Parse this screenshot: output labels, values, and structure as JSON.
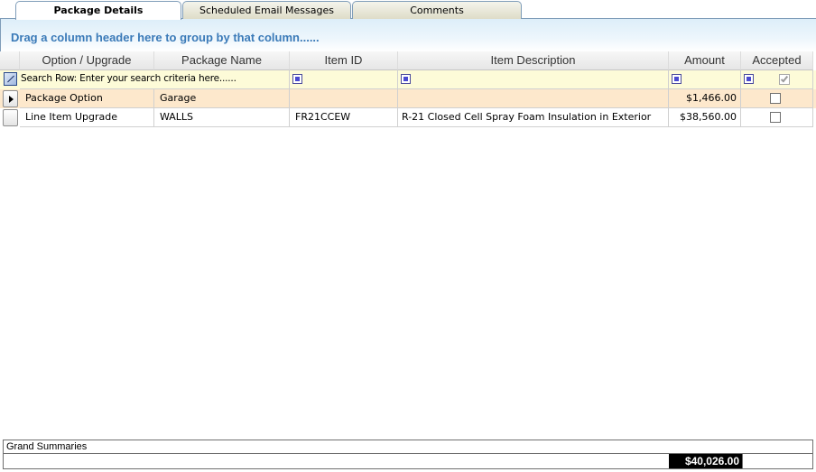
{
  "tabs": [
    {
      "label": "Package Details",
      "active": true
    },
    {
      "label": "Scheduled Email Messages",
      "active": false
    },
    {
      "label": "Comments",
      "active": false
    }
  ],
  "groupby": {
    "prompt": "Drag a column header here to group by that column......"
  },
  "columns": {
    "option": "Option / Upgrade",
    "package": "Package Name",
    "item_id": "Item ID",
    "description": "Item Description",
    "amount": "Amount",
    "accepted": "Accepted"
  },
  "search_row": {
    "prompt": "Search Row: Enter your search criteria here......",
    "accepted_checked": true
  },
  "rows": [
    {
      "option": "Package Option",
      "package": "Garage",
      "item_id": "",
      "description": "",
      "amount": "$1,466.00",
      "accepted": false
    },
    {
      "option": "Line Item Upgrade",
      "package": "WALLS",
      "item_id": "FR21CCEW",
      "description": "R-21 Closed Cell Spray Foam Insulation in Exterior",
      "amount": "$38,560.00",
      "accepted": false
    }
  ],
  "summaries": {
    "label": "Grand Summaries",
    "total": "$40,026.00"
  },
  "colors": {
    "group_prompt": "#3a7ab8",
    "selected_row": "#fde8cc",
    "search_row": "#fdfbd8"
  }
}
